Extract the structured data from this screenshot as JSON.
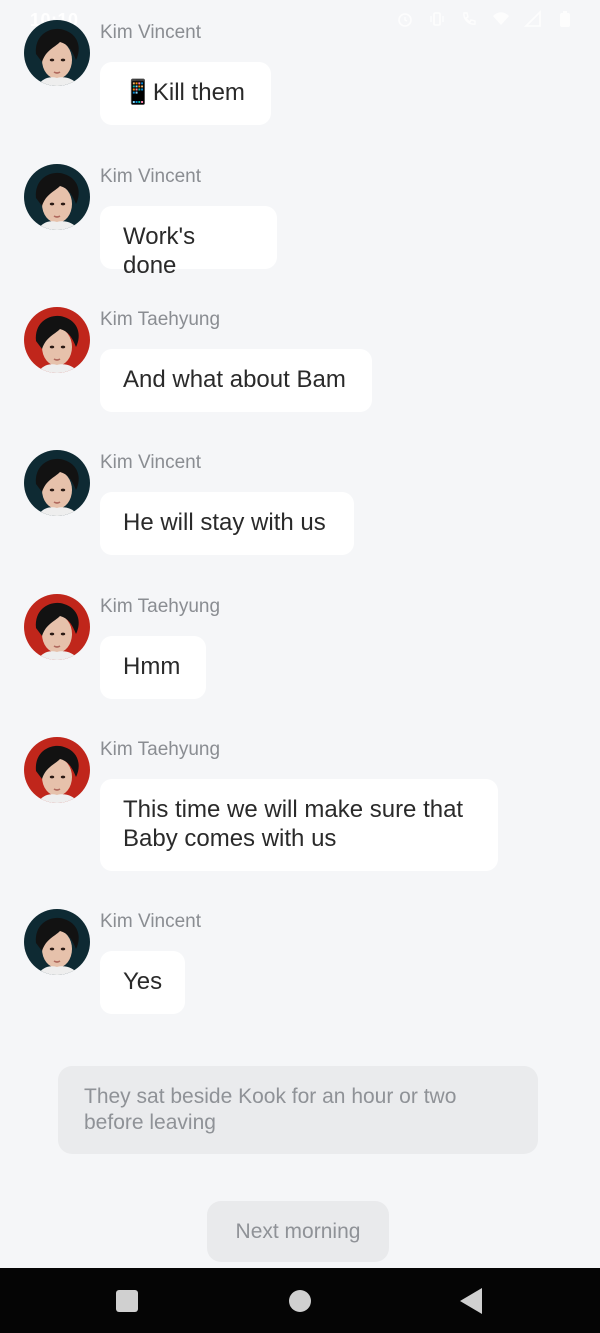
{
  "status_bar": {
    "time": "10:10",
    "icons": [
      "alarm-icon",
      "vibrate-icon",
      "call-icon",
      "wifi-icon",
      "signal-icon",
      "battery-icon"
    ]
  },
  "messages": [
    {
      "sender": "Kim Vincent",
      "text": "📱Kill them",
      "avatar": "vincent"
    },
    {
      "sender": "Kim Vincent",
      "text": "Work's done",
      "avatar": "vincent"
    },
    {
      "sender": "Kim Taehyung",
      "text": "And what about Bam",
      "avatar": "taehyung"
    },
    {
      "sender": "Kim Vincent",
      "text": "He will stay with us",
      "avatar": "vincent"
    },
    {
      "sender": "Kim Taehyung",
      "text": "Hmm",
      "avatar": "taehyung"
    },
    {
      "sender": "Kim Taehyung",
      "text": "This time we will make sure that\nBaby comes with us",
      "avatar": "taehyung"
    },
    {
      "sender": "Kim Vincent",
      "text": "Yes",
      "avatar": "vincent"
    }
  ],
  "narration": "They sat beside Kook for an hour or two before leaving",
  "next_button": "Next morning",
  "nav_bar": {
    "icons": [
      "recents-icon",
      "home-icon",
      "back-icon"
    ]
  },
  "colors": {
    "background": "#f5f6f8",
    "bubble": "#ffffff",
    "avatar_vincent_bg": "#0e2a33",
    "avatar_taehyung_bg": "#c0261b"
  }
}
